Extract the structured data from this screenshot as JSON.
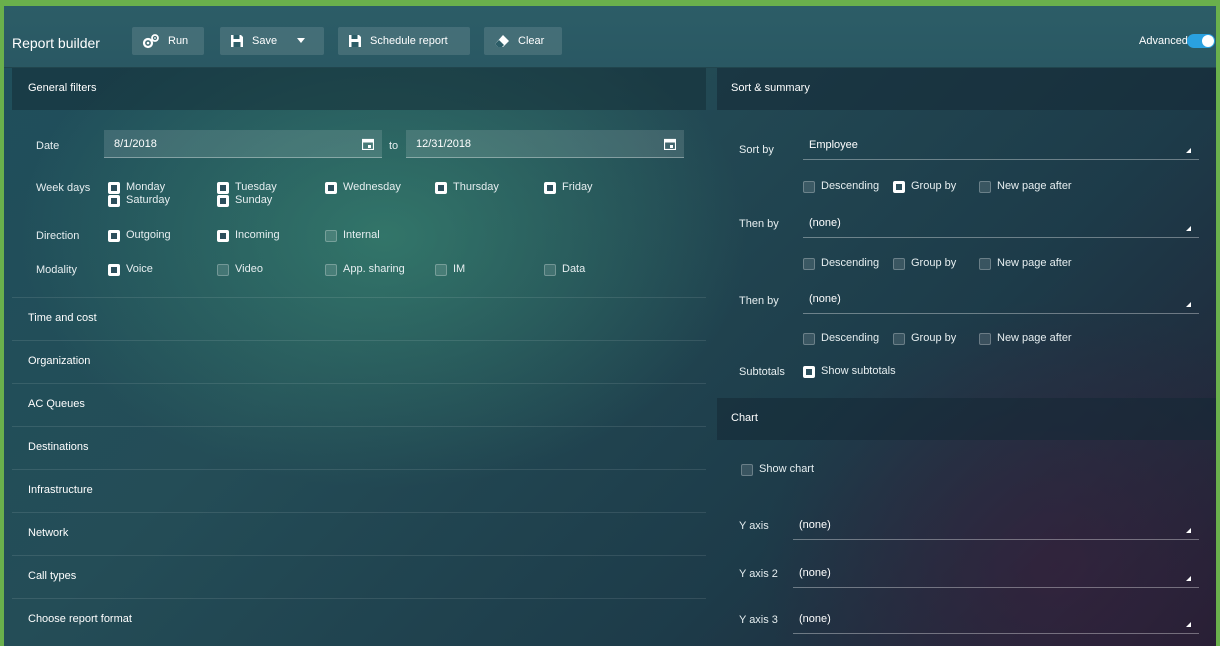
{
  "toolbar": {
    "title": "Report builder",
    "run_label": "Run",
    "save_label": "Save",
    "schedule_label": "Schedule report",
    "clear_label": "Clear",
    "advanced_label": "Advanced",
    "advanced_on": true
  },
  "general_filters": {
    "title": "General filters",
    "date_label": "Date",
    "date_from": "8/1/2018",
    "to_label": "to",
    "date_to": "12/31/2018",
    "weekdays_label": "Week days",
    "weekdays": [
      {
        "label": "Monday",
        "checked": true
      },
      {
        "label": "Saturday",
        "checked": true
      },
      {
        "label": "Tuesday",
        "checked": true
      },
      {
        "label": "Sunday",
        "checked": true
      },
      {
        "label": "Wednesday",
        "checked": true
      },
      {
        "label": "Thursday",
        "checked": true
      },
      {
        "label": "Friday",
        "checked": true
      }
    ],
    "direction_label": "Direction",
    "direction": [
      {
        "label": "Outgoing",
        "checked": true
      },
      {
        "label": "Incoming",
        "checked": true
      },
      {
        "label": "Internal",
        "checked": false
      }
    ],
    "modality_label": "Modality",
    "modality": [
      {
        "label": "Voice",
        "checked": true
      },
      {
        "label": "Video",
        "checked": false
      },
      {
        "label": "App. sharing",
        "checked": false
      },
      {
        "label": "IM",
        "checked": false
      },
      {
        "label": "Data",
        "checked": false
      }
    ]
  },
  "sections": [
    "Time and cost",
    "Organization",
    "AC Queues",
    "Destinations",
    "Infrastructure",
    "Network",
    "Call types",
    "Choose report format"
  ],
  "sort_summary": {
    "title": "Sort & summary",
    "sort_by_label": "Sort by",
    "sort_by_value": "Employee",
    "then_by_label": "Then by",
    "then_by_1_value": "(none)",
    "then_by_2_value": "(none)",
    "descending_label": "Descending",
    "group_by_label": "Group by",
    "new_page_label": "New page after",
    "rows": [
      {
        "descending": false,
        "group_by": true,
        "new_page": false
      },
      {
        "descending": false,
        "group_by": false,
        "new_page": false
      },
      {
        "descending": false,
        "group_by": false,
        "new_page": false
      }
    ],
    "subtotals_label": "Subtotals",
    "show_subtotals_label": "Show subtotals",
    "show_subtotals": true
  },
  "chart": {
    "title": "Chart",
    "show_chart_label": "Show chart",
    "show_chart": false,
    "y_axis_label": "Y axis",
    "y_axis_value": "(none)",
    "y_axis2_label": "Y axis 2",
    "y_axis2_value": "(none)",
    "y_axis3_label": "Y axis 3",
    "y_axis3_value": "(none)"
  }
}
